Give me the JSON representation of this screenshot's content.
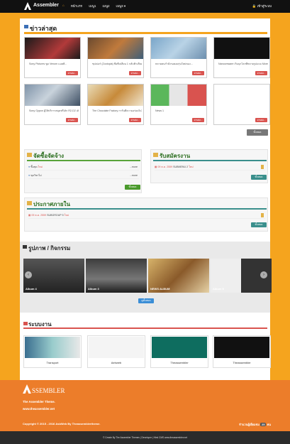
{
  "topbar": {
    "brand": "Assembler",
    "nav": [
      "หน้าแรก",
      "เมนู1",
      "เมนู2",
      "เมนู3 ▾"
    ],
    "login": "เข้าสู่ระบบ"
  },
  "news": {
    "title": "ข่าวล่าสุด",
    "read_label": "อ่านต่อ...",
    "all_label": "ทั้งหมด",
    "items": [
      {
        "title": "Sony Pictures ชูด Venom แอคติ..."
      },
      {
        "title": "ซุปเปอร์ (Zootopia) ชื่อที่เปลี่ยน 1 กลับฟ้าเสียงของ Disney"
      },
      {
        "title": "หลายคนกำลังรอคอยรุ่นใหม่ของ..."
      },
      {
        "title": "Nanoomware เริ่มบุกโลกที่หลายรูปแบบ More แล้ว"
      },
      {
        "title": "Sony Gypon ผู้ให้บริการสมุดฟรีเล็ก R2-D2 เล็กที่โอนด์"
      },
      {
        "title": "The Chocolate Factory การันตีความอร่อยในไม่ได้ชิมอย่างน่าทาน"
      },
      {
        "title": "News 1"
      },
      {
        "title": ""
      }
    ]
  },
  "procurement": {
    "title": "จัดซื้อจัดจ้าง",
    "rows": [
      {
        "label": "ซื้อชุด",
        "tag": "ใหม่",
        "more": "...more"
      },
      {
        "label": "ชุดวิชาไม่",
        "tag": "",
        "more": "...more"
      }
    ],
    "all_label": "ทั้งหมด"
  },
  "jobs": {
    "title": "รับสมัครงาน",
    "rows": [
      {
        "date": "09 ต.ค. 2559",
        "label": "SUBMENU 2",
        "tag": "ใหม่"
      }
    ],
    "all_label": "ทั้งหมด"
  },
  "announce": {
    "title": "ประกาศภายใน",
    "rows": [
      {
        "date": "09 ต.ค. 2559",
        "label": "SUBGROUP 5",
        "tag": "ใหม่"
      }
    ],
    "all_label": "ทั้งหมด"
  },
  "gallery": {
    "title": "รูปภาพ / กิจกรรม",
    "items": [
      "Album 4",
      "Album 3",
      "NEWS ALBUM",
      "Album 5"
    ],
    "all_label": "ดูทั้งหมด"
  },
  "systems": {
    "title": "ระบบงาน",
    "items": [
      "Transport",
      "Aebweb",
      "Theassembler",
      "Theassembler"
    ]
  },
  "footer": {
    "logo_text": "SSEMBLER",
    "company": "The Assembler Theme.",
    "site": "www.theassembler.net",
    "copyright": "Copyright © 2015 - 2016 AsbWeb By Theassemblertheme.",
    "visitors_label": "จำนวนผู้เยี่ยมชม",
    "visitors_count": "25",
    "visitors_unit": "คน",
    "bottom": "© Create By The Assembler Themes | Developer | Html CMS www.theassembler.net"
  },
  "colors": {
    "accent": "#f5a41e",
    "footer": "#ec7d2a",
    "read_btn": "#d9534f",
    "green": "#4a9a2c"
  }
}
